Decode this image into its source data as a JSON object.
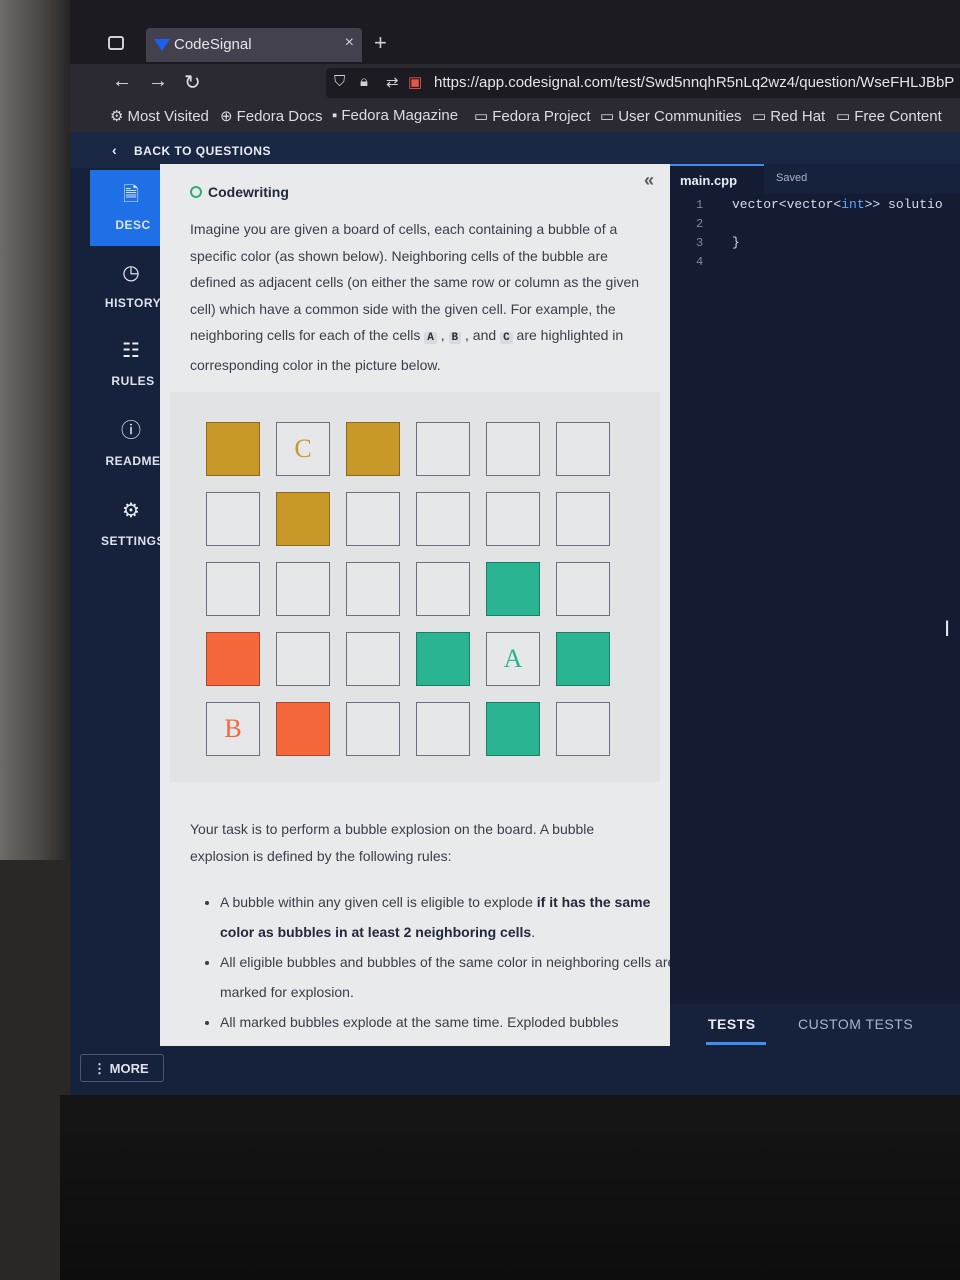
{
  "browser": {
    "tab_title": "CodeSignal",
    "tab_close": "×",
    "new_tab": "+",
    "url": "https://app.codesignal.com/test/Swd5nnqhR5nLq2wz4/question/WseFHLJBbP",
    "bookmarks": [
      "Most Visited",
      "Fedora Docs",
      "Fedora Magazine",
      "Fedora Project",
      "User Communities",
      "Red Hat",
      "Free Content"
    ]
  },
  "page": {
    "back_label": "BACK TO QUESTIONS",
    "sidebar": [
      {
        "label": "DESC",
        "icon": "document-icon"
      },
      {
        "label": "HISTORY",
        "icon": "clock-icon"
      },
      {
        "label": "RULES",
        "icon": "list-icon"
      },
      {
        "label": "README",
        "icon": "info-icon"
      },
      {
        "label": "SETTINGS",
        "icon": "gear-icon"
      }
    ],
    "more_label": "MORE",
    "collapse_glyph": "«"
  },
  "description": {
    "heading": "Codewriting",
    "intro_before": "Imagine you are given a board of cells, each containing a bubble of a specific color (as shown below). Neighboring cells of the bubble are defined as adjacent cells (on either the same row or column as the given cell) which have a common side with the given cell. For example, the neighboring cells for each of the cells ",
    "cell_a": "A",
    "comma": " , ",
    "cell_b": "B",
    "and_text": " , and ",
    "cell_c": "C",
    "intro_after": " are highlighted in corresponding color in the picture below.",
    "board": [
      [
        {
          "color": "gold"
        },
        {
          "color": "empty",
          "letter": "C"
        },
        {
          "color": "gold"
        },
        {
          "color": "empty"
        },
        {
          "color": "empty"
        },
        {
          "color": "empty"
        }
      ],
      [
        {
          "color": "empty"
        },
        {
          "color": "gold"
        },
        {
          "color": "empty"
        },
        {
          "color": "empty"
        },
        {
          "color": "empty"
        },
        {
          "color": "empty"
        }
      ],
      [
        {
          "color": "empty"
        },
        {
          "color": "empty"
        },
        {
          "color": "empty"
        },
        {
          "color": "empty"
        },
        {
          "color": "teal"
        },
        {
          "color": "empty"
        }
      ],
      [
        {
          "color": "orange"
        },
        {
          "color": "empty"
        },
        {
          "color": "empty"
        },
        {
          "color": "teal"
        },
        {
          "color": "empty",
          "letter": "A"
        },
        {
          "color": "teal"
        }
      ],
      [
        {
          "color": "empty",
          "letter": "B"
        },
        {
          "color": "orange"
        },
        {
          "color": "empty"
        },
        {
          "color": "empty"
        },
        {
          "color": "teal"
        },
        {
          "color": "empty"
        }
      ]
    ],
    "letter_colors": {
      "A": "#2ab491",
      "B": "#f4683b",
      "C": "#c89828"
    },
    "task": "Your task is to perform a bubble explosion on the board. A bubble explosion is defined by the following rules:",
    "rule1_before": "A bubble within any given cell is eligible to explode ",
    "rule1_bold": "if it has the same color as bubbles in at least 2 neighboring cells",
    "rule1_after": ".",
    "rule2": "All eligible bubbles and bubbles of the same color in neighboring cells are marked for explosion.",
    "rule3": "All marked bubbles explode at the same time. Exploded bubbles"
  },
  "editor": {
    "file_tab": "main.cpp",
    "status": "Saved",
    "line_numbers": [
      "1",
      "2",
      "3",
      "4"
    ],
    "line1_type": "vector<vector<",
    "line1_kw": "int",
    "line1_rest": ">> solutio",
    "line3": "}",
    "tests_tab": "TESTS",
    "custom_tests_tab": "CUSTOM TESTS"
  }
}
